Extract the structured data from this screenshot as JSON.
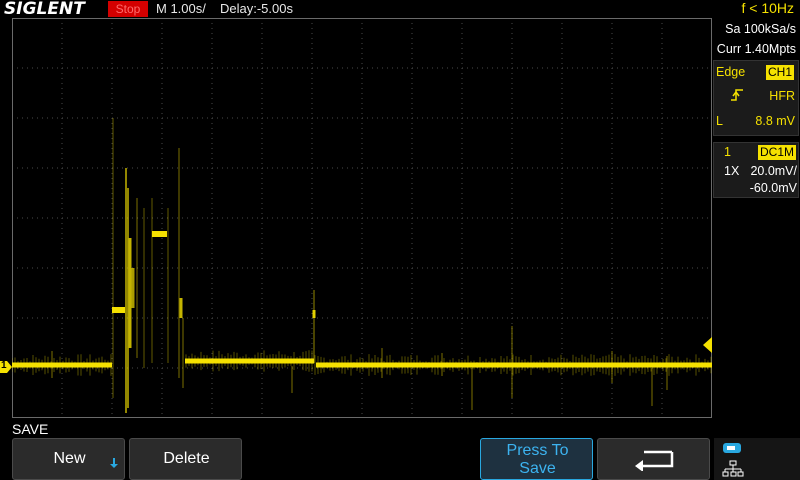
{
  "header": {
    "brand": "SIGLENT",
    "run_status": "Stop",
    "timebase": "M 1.00s/",
    "delay": "Delay:-5.00s",
    "frequency": "f < 10Hz"
  },
  "acquisition": {
    "sample_rate": "Sa 100kSa/s",
    "memory": "Curr 1.40Mpts"
  },
  "trigger": {
    "type": "Edge",
    "source": "CH1",
    "coupling": "HFR",
    "level_label": "L",
    "level": "8.8 mV"
  },
  "channel1": {
    "number": "1",
    "coupling": "DC1M",
    "probe": "1X",
    "scale": "20.0mV/",
    "offset": "-60.0mV",
    "marker": "1"
  },
  "menu": {
    "title": "SAVE",
    "new_label": "New",
    "delete_label": "Delete",
    "press_to_save_line1": "Press To",
    "press_to_save_line2": "Save"
  },
  "colors": {
    "trace": "#f5e100",
    "grid": "#5a5a5a",
    "stop": "#d40000",
    "accent": "#29a8e0"
  }
}
